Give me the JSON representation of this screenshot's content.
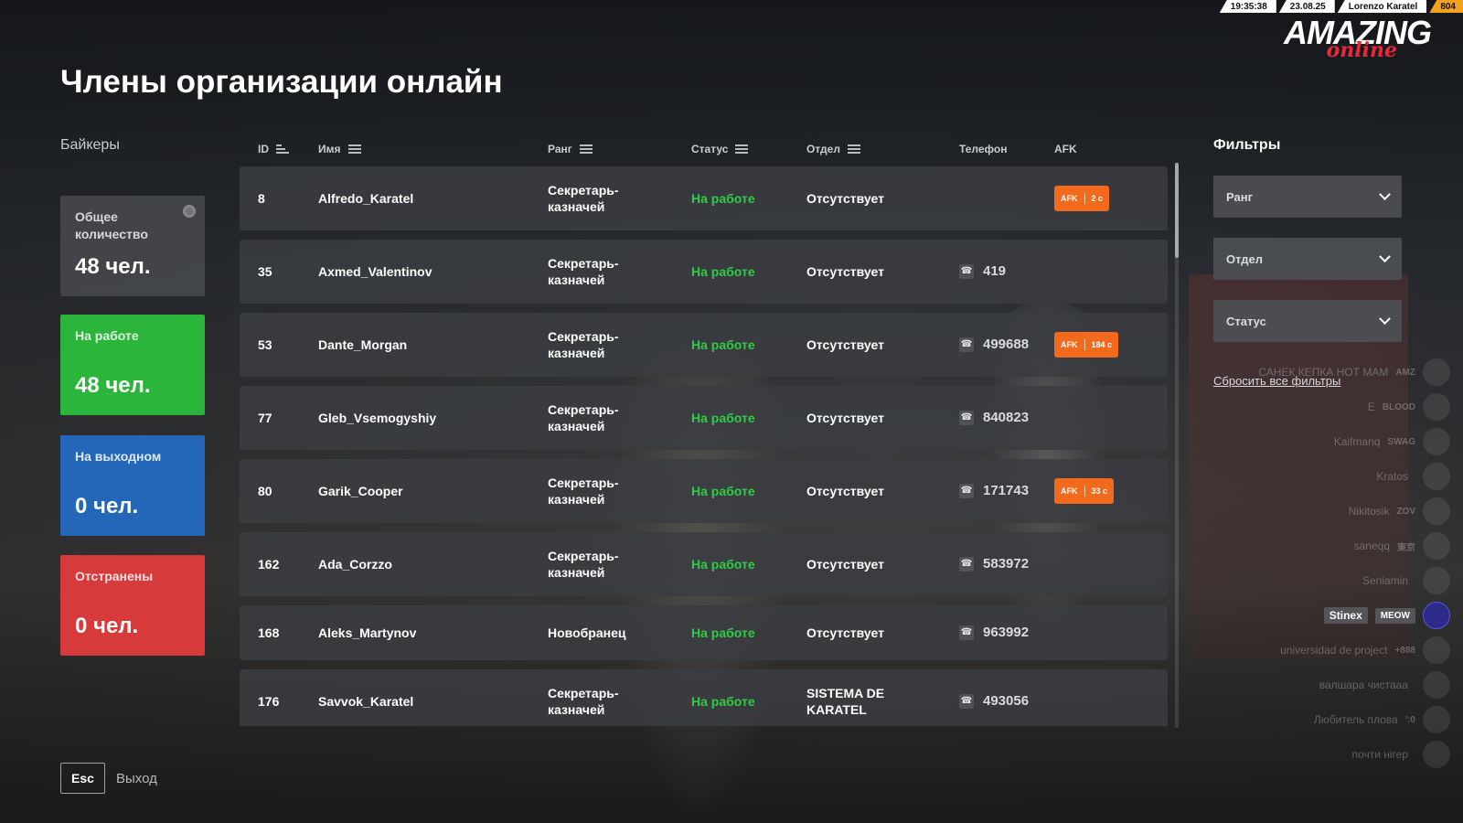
{
  "topbar": {
    "time": "19:35:38",
    "date": "23.08.25",
    "player": "Lorenzo Karatel",
    "server": "804"
  },
  "logo": {
    "main": "AMAZING",
    "sub": "online"
  },
  "page": {
    "title": "Члены организации онлайн",
    "org_name": "Байкеры"
  },
  "stats": {
    "total": {
      "label": "Общее количество",
      "value": "48 чел."
    },
    "working": {
      "label": "На работе",
      "value": "48 чел.",
      "color": "#2bb53a"
    },
    "dayoff": {
      "label": "На выходном",
      "value": "0 чел.",
      "color": "#2467b8"
    },
    "removed": {
      "label": "Отстранены",
      "value": "0 чел.",
      "color": "#d63a3a"
    }
  },
  "table": {
    "headers": {
      "id": "ID",
      "name": "Имя",
      "rank": "Ранг",
      "status": "Статус",
      "dept": "Отдел",
      "phone": "Телефон",
      "afk": "AFK"
    },
    "rows": [
      {
        "id": "8",
        "name": "Alfredo_Karatel",
        "rank": "Секретарь-казначей",
        "status": "На работе",
        "dept": "Отсутствует",
        "phone": "",
        "afk_label": "AFK",
        "afk_time": "2 с"
      },
      {
        "id": "35",
        "name": "Axmed_Valentinov",
        "rank": "Секретарь-казначей",
        "status": "На работе",
        "dept": "Отсутствует",
        "phone": "419",
        "afk_label": "",
        "afk_time": ""
      },
      {
        "id": "53",
        "name": "Dante_Morgan",
        "rank": "Секретарь-казначей",
        "status": "На работе",
        "dept": "Отсутствует",
        "phone": "499688",
        "afk_label": "AFK",
        "afk_time": "184 с"
      },
      {
        "id": "77",
        "name": "Gleb_Vsemogyshiy",
        "rank": "Секретарь-казначей",
        "status": "На работе",
        "dept": "Отсутствует",
        "phone": "840823",
        "afk_label": "",
        "afk_time": ""
      },
      {
        "id": "80",
        "name": "Garik_Cooper",
        "rank": "Секретарь-казначей",
        "status": "На работе",
        "dept": "Отсутствует",
        "phone": "171743",
        "afk_label": "AFK",
        "afk_time": "33 с"
      },
      {
        "id": "162",
        "name": "Ada_Corzzo",
        "rank": "Секретарь-казначей",
        "status": "На работе",
        "dept": "Отсутствует",
        "phone": "583972",
        "afk_label": "",
        "afk_time": ""
      },
      {
        "id": "168",
        "name": "Aleks_Martynov",
        "rank": "Новобранец",
        "status": "На работе",
        "dept": "Отсутствует",
        "phone": "963992",
        "afk_label": "",
        "afk_time": ""
      },
      {
        "id": "176",
        "name": "Savvok_Karatel",
        "rank": "Секретарь-казначей",
        "status": "На работе",
        "dept": "SISTEMA DE KARATEL",
        "phone": "493056",
        "afk_label": "",
        "afk_time": ""
      }
    ],
    "status_color": "#2fcb45",
    "afk_color": "#f46a1c"
  },
  "filters": {
    "title": "Фильтры",
    "rank": "Ранг",
    "dept": "Отдел",
    "status": "Статус",
    "reset": "Сбросить все фильтры"
  },
  "player_list": [
    {
      "name": "САНЕК КЕПКА НОТ МАМ",
      "tag": "AMZ"
    },
    {
      "name": "E",
      "tag": "BLOOD"
    },
    {
      "name": "Kaifmanq",
      "tag": "SWAG"
    },
    {
      "name": "Kratos",
      "tag": ""
    },
    {
      "name": "Nikitosik",
      "tag": "ZOV"
    },
    {
      "name": "saneqq",
      "tag": "東京"
    },
    {
      "name": "Seniamin",
      "tag": ""
    },
    {
      "name": "Stinex",
      "tag": "MEOW",
      "highlight": true
    },
    {
      "name": "universidad de project",
      "tag": "+888"
    },
    {
      "name": "валшара чистааа",
      "tag": ""
    },
    {
      "name": "Любитель плова",
      "tag": "':0"
    },
    {
      "name": "почти нігер",
      "tag": ""
    }
  ],
  "footer": {
    "esc_key": "Esc",
    "esc_label": "Выход"
  }
}
